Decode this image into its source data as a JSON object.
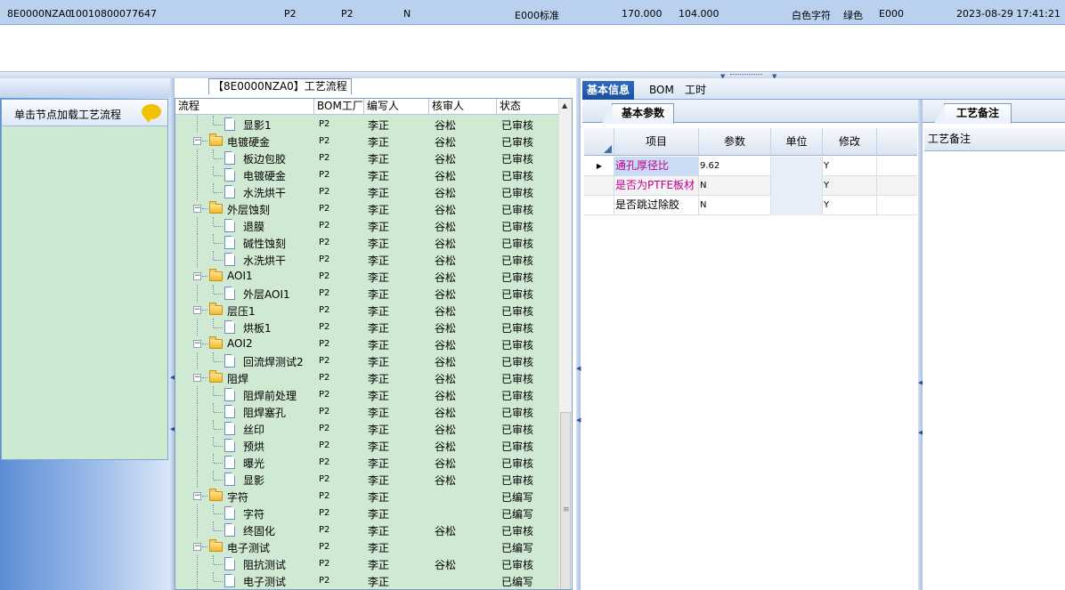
{
  "top_row": {
    "cells": [
      "8E0000NZA0",
      "10010800077647",
      "P2",
      "P2",
      "N",
      "E000标准",
      "170.000",
      "104.000",
      "白色字符",
      "绿色",
      "E000",
      "2023-08-29 17:41:21"
    ]
  },
  "left_panel": {
    "hint": "单击节点加载工艺流程"
  },
  "tree": {
    "title": "【8E0000NZA0】工艺流程",
    "columns": [
      "流程",
      "BOM工厂",
      "编写人",
      "核审人",
      "状态"
    ],
    "rows": [
      {
        "name": "显影1",
        "level": 1,
        "folder": false,
        "factory": "P2",
        "writer": "李正",
        "reviewer": "谷松",
        "status": "已审核"
      },
      {
        "name": "电镀硬金",
        "level": 0,
        "folder": true,
        "factory": "P2",
        "writer": "李正",
        "reviewer": "谷松",
        "status": "已审核"
      },
      {
        "name": "板边包胶",
        "level": 1,
        "folder": false,
        "factory": "P2",
        "writer": "李正",
        "reviewer": "谷松",
        "status": "已审核"
      },
      {
        "name": "电镀硬金",
        "level": 1,
        "folder": false,
        "factory": "P2",
        "writer": "李正",
        "reviewer": "谷松",
        "status": "已审核"
      },
      {
        "name": "水洗烘干",
        "level": 1,
        "folder": false,
        "factory": "P2",
        "writer": "李正",
        "reviewer": "谷松",
        "status": "已审核"
      },
      {
        "name": "外层蚀刻",
        "level": 0,
        "folder": true,
        "factory": "P2",
        "writer": "李正",
        "reviewer": "谷松",
        "status": "已审核"
      },
      {
        "name": "退膜",
        "level": 1,
        "folder": false,
        "factory": "P2",
        "writer": "李正",
        "reviewer": "谷松",
        "status": "已审核"
      },
      {
        "name": "碱性蚀刻",
        "level": 1,
        "folder": false,
        "factory": "P2",
        "writer": "李正",
        "reviewer": "谷松",
        "status": "已审核"
      },
      {
        "name": "水洗烘干",
        "level": 1,
        "folder": false,
        "factory": "P2",
        "writer": "李正",
        "reviewer": "谷松",
        "status": "已审核"
      },
      {
        "name": "AOI1",
        "level": 0,
        "folder": true,
        "factory": "P2",
        "writer": "李正",
        "reviewer": "谷松",
        "status": "已审核"
      },
      {
        "name": "外层AOI1",
        "level": 1,
        "folder": false,
        "factory": "P2",
        "writer": "李正",
        "reviewer": "谷松",
        "status": "已审核"
      },
      {
        "name": "层压1",
        "level": 0,
        "folder": true,
        "factory": "P2",
        "writer": "李正",
        "reviewer": "谷松",
        "status": "已审核"
      },
      {
        "name": "烘板1",
        "level": 1,
        "folder": false,
        "factory": "P2",
        "writer": "李正",
        "reviewer": "谷松",
        "status": "已审核"
      },
      {
        "name": "AOI2",
        "level": 0,
        "folder": true,
        "factory": "P2",
        "writer": "李正",
        "reviewer": "谷松",
        "status": "已审核"
      },
      {
        "name": "回流焊测试2",
        "level": 1,
        "folder": false,
        "factory": "P2",
        "writer": "李正",
        "reviewer": "谷松",
        "status": "已审核"
      },
      {
        "name": "阻焊",
        "level": 0,
        "folder": true,
        "factory": "P2",
        "writer": "李正",
        "reviewer": "谷松",
        "status": "已审核"
      },
      {
        "name": "阻焊前处理",
        "level": 1,
        "folder": false,
        "factory": "P2",
        "writer": "李正",
        "reviewer": "谷松",
        "status": "已审核"
      },
      {
        "name": "阻焊塞孔",
        "level": 1,
        "folder": false,
        "factory": "P2",
        "writer": "李正",
        "reviewer": "谷松",
        "status": "已审核"
      },
      {
        "name": "丝印",
        "level": 1,
        "folder": false,
        "factory": "P2",
        "writer": "李正",
        "reviewer": "谷松",
        "status": "已审核"
      },
      {
        "name": "预烘",
        "level": 1,
        "folder": false,
        "factory": "P2",
        "writer": "李正",
        "reviewer": "谷松",
        "status": "已审核"
      },
      {
        "name": "曝光",
        "level": 1,
        "folder": false,
        "factory": "P2",
        "writer": "李正",
        "reviewer": "谷松",
        "status": "已审核"
      },
      {
        "name": "显影",
        "level": 1,
        "folder": false,
        "factory": "P2",
        "writer": "李正",
        "reviewer": "谷松",
        "status": "已审核"
      },
      {
        "name": "字符",
        "level": 0,
        "folder": true,
        "factory": "P2",
        "writer": "李正",
        "reviewer": "",
        "status": "已编写"
      },
      {
        "name": "字符",
        "level": 1,
        "folder": false,
        "factory": "P2",
        "writer": "李正",
        "reviewer": "",
        "status": "已编写"
      },
      {
        "name": "终固化",
        "level": 1,
        "folder": false,
        "factory": "P2",
        "writer": "李正",
        "reviewer": "谷松",
        "status": "已审核"
      },
      {
        "name": "电子测试",
        "level": 0,
        "folder": true,
        "factory": "P2",
        "writer": "李正",
        "reviewer": "",
        "status": "已编写"
      },
      {
        "name": "阻抗测试",
        "level": 1,
        "folder": false,
        "factory": "P2",
        "writer": "李正",
        "reviewer": "谷松",
        "status": "已审核"
      },
      {
        "name": "电子测试",
        "level": 1,
        "folder": false,
        "factory": "P2",
        "writer": "李正",
        "reviewer": "",
        "status": "已编写"
      }
    ]
  },
  "right_tabs": [
    "基本信息",
    "BOM",
    "工时"
  ],
  "basic": {
    "subtab": "基本参数",
    "columns": [
      "项目",
      "参数",
      "单位",
      "修改"
    ],
    "rows": [
      {
        "item": "通孔厚径比",
        "value": "9.62",
        "unit": "",
        "modify": "Y",
        "color": "#c0008c"
      },
      {
        "item": "是否为PTFE板材",
        "value": "N",
        "unit": "",
        "modify": "Y",
        "color": "#c0008c"
      },
      {
        "item": "是否跳过除胶",
        "value": "N",
        "unit": "",
        "modify": "Y",
        "color": "#000000"
      }
    ]
  },
  "notes": {
    "tab": "工艺备注",
    "header": "工艺备注"
  }
}
